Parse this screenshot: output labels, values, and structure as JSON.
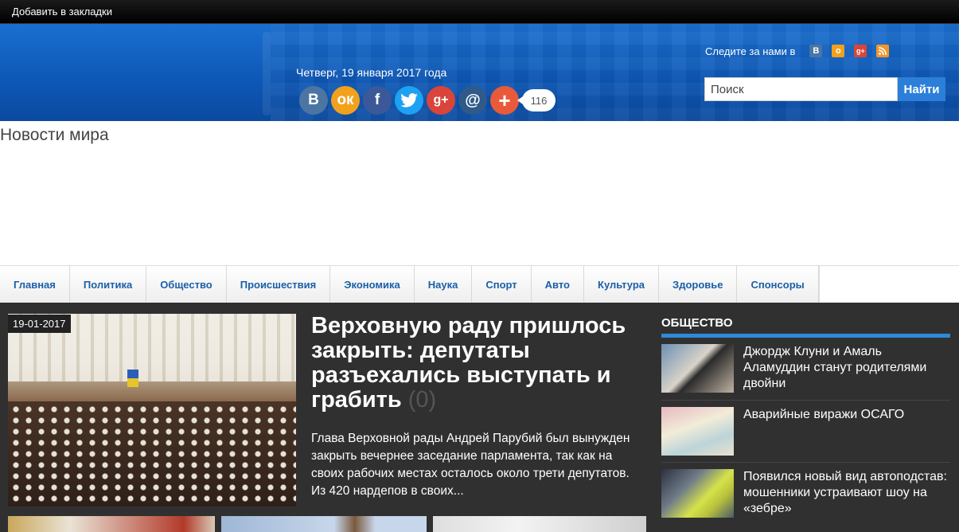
{
  "topbar": {
    "bookmark_label": "Добавить в закладки"
  },
  "header": {
    "date": "Четверг, 19 января 2017 года",
    "share_count": "116",
    "follow_label": "Следите за нами в",
    "search": {
      "placeholder": "Поиск",
      "button_label": "Найти"
    }
  },
  "site_title": "Новости мира",
  "nav": {
    "items": [
      "Главная",
      "Политика",
      "Общество",
      "Происшествия",
      "Экономика",
      "Наука",
      "Спорт",
      "Авто",
      "Культура",
      "Здоровье",
      "Спонсоры"
    ]
  },
  "featured": {
    "date": "19-01-2017",
    "title": "Верховную раду пришлось закрыть: депутаты разъехались выступать и грабить",
    "comments": "(0)",
    "excerpt": "Глава Верховной рады Андрей Парубий был вынужден закрыть вечернее заседание парламента, так как на своих рабочих местах осталось около трети депутатов. Из 420 нардепов в своих..."
  },
  "sidebar": {
    "heading": "ОБЩЕСТВО",
    "items": [
      {
        "title": "Джордж Клуни и Амаль Аламуддин станут родителями двойни"
      },
      {
        "title": "Аварийные виражи ОСАГО"
      },
      {
        "title": "Появился новый вид автоподстав: мошенники устраивают шоу на «зебре»"
      }
    ]
  },
  "colors": {
    "header_blue": "#0d57b5",
    "nav_text": "#1a5fa8",
    "main_bg": "#303030",
    "accent": "#2d8ad8",
    "vk": "#4c75a3",
    "ok": "#f2a11d",
    "facebook": "#3b5998",
    "twitter": "#1da1f2",
    "gplus": "#d9453a",
    "mail": "#2f5a8a",
    "more": "#e85a3a",
    "rss": "#f2952a"
  }
}
